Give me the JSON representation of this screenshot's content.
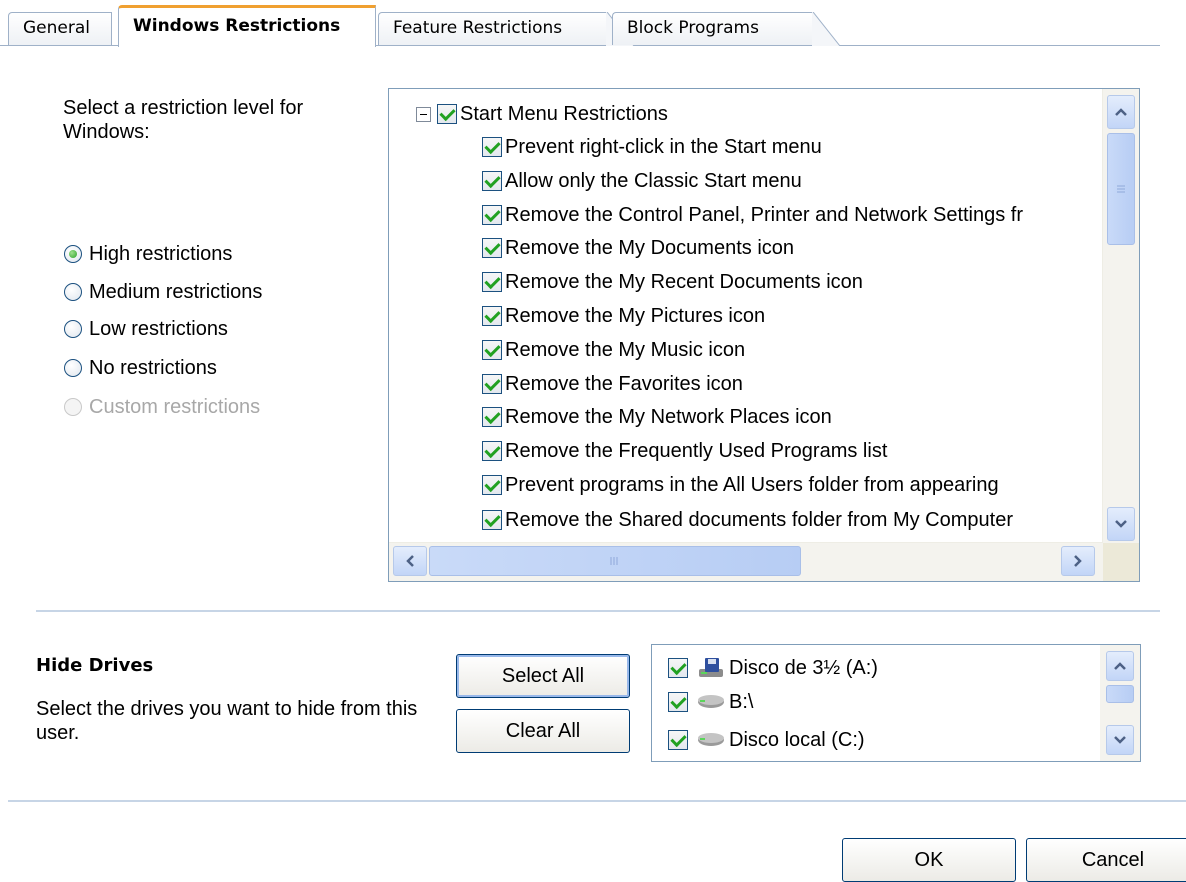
{
  "tabs": [
    {
      "label": "General",
      "active": false
    },
    {
      "label": "Windows Restrictions",
      "active": true
    },
    {
      "label": "Feature Restrictions",
      "active": false
    },
    {
      "label": "Block Programs",
      "active": false
    }
  ],
  "restriction": {
    "prompt": "Select a restriction level for Windows:",
    "options": [
      {
        "label": "High restrictions",
        "checked": true,
        "enabled": true
      },
      {
        "label": "Medium restrictions",
        "checked": false,
        "enabled": true
      },
      {
        "label": "Low restrictions",
        "checked": false,
        "enabled": true
      },
      {
        "label": "No restrictions",
        "checked": false,
        "enabled": true
      },
      {
        "label": "Custom restrictions",
        "checked": false,
        "enabled": false
      }
    ]
  },
  "tree": {
    "root": {
      "label": "Start Menu Restrictions",
      "checked": true,
      "expanded": true
    },
    "items": [
      {
        "label": "Prevent right-click in the Start menu",
        "checked": true
      },
      {
        "label": "Allow only the Classic Start menu",
        "checked": true
      },
      {
        "label": "Remove the Control Panel, Printer and Network Settings fr",
        "checked": true
      },
      {
        "label": "Remove the My Documents icon",
        "checked": true
      },
      {
        "label": "Remove the My Recent Documents icon",
        "checked": true
      },
      {
        "label": "Remove the My Pictures icon",
        "checked": true
      },
      {
        "label": "Remove the My Music icon",
        "checked": true
      },
      {
        "label": "Remove the Favorites icon",
        "checked": true
      },
      {
        "label": "Remove the My Network Places icon",
        "checked": true
      },
      {
        "label": "Remove the Frequently Used Programs list",
        "checked": true
      },
      {
        "label": "Prevent programs in the All Users folder from appearing",
        "checked": true
      },
      {
        "label": "Remove the Shared documents folder from My Computer",
        "checked": true
      }
    ]
  },
  "hide_drives": {
    "title": "Hide Drives",
    "description": "Select the drives you want to hide from this user.",
    "select_all_label": "Select All",
    "clear_all_label": "Clear All",
    "drives": [
      {
        "label": "Disco de 3½ (A:)",
        "checked": true,
        "icon": "floppy-drive-icon"
      },
      {
        "label": "B:\\",
        "checked": true,
        "icon": "disk-drive-icon"
      },
      {
        "label": "Disco local (C:)",
        "checked": true,
        "icon": "disk-drive-icon"
      }
    ]
  },
  "footer": {
    "ok_label": "OK",
    "cancel_label": "Cancel"
  },
  "colors": {
    "accent": "#f0a030",
    "check": "#21a121",
    "border": "#7f9db9",
    "scrollbar": "#c2d5f7"
  }
}
